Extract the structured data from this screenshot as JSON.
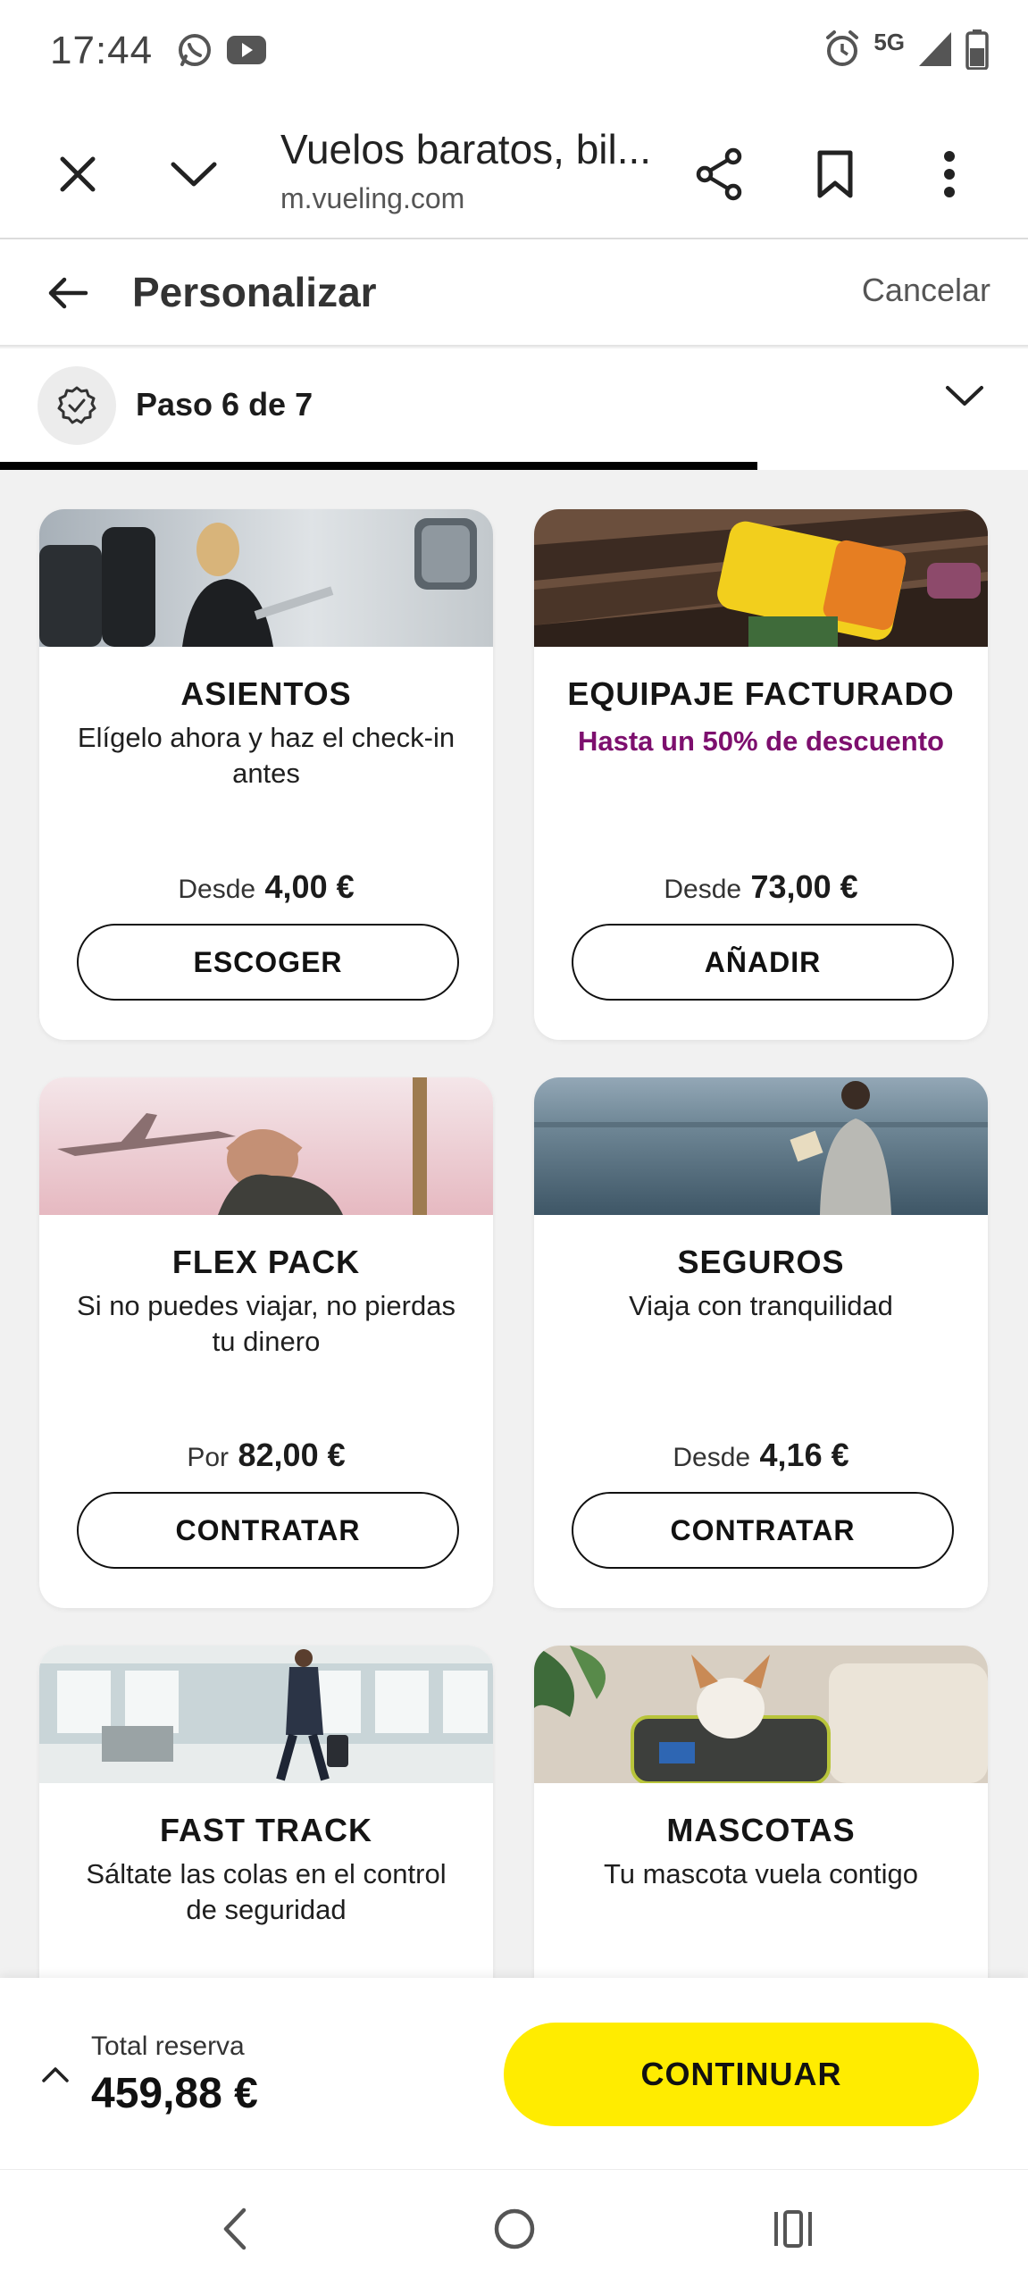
{
  "status_bar": {
    "time": "17:44",
    "left_icons": [
      "whatsapp-icon",
      "youtube-icon"
    ],
    "network": "5G",
    "right_icons": [
      "alarm-icon",
      "signal-icon",
      "battery-icon"
    ]
  },
  "browser": {
    "title": "Vuelos baratos, bil...",
    "url": "m.vueling.com",
    "icons": [
      "close-icon",
      "chevron-down-icon",
      "share-icon",
      "bookmark-icon",
      "more-vert-icon"
    ]
  },
  "header": {
    "title": "Personalizar",
    "cancel_label": "Cancelar"
  },
  "step": {
    "label": "Paso 6 de 7",
    "progress_fraction": 0.857
  },
  "cards": [
    {
      "title": "ASIENTOS",
      "subtitle": "Elígelo ahora y haz el check-in antes",
      "price_prefix": "Desde",
      "price": "4,00 €",
      "button": "ESCOGER"
    },
    {
      "title": "EQUIPAJE FACTURADO",
      "subtitle": "Hasta un 50% de descuento",
      "price_prefix": "Desde",
      "price": "73,00 €",
      "button": "AÑADIR"
    },
    {
      "title": "FLEX PACK",
      "subtitle": "Si no puedes viajar, no pierdas tu dinero",
      "price_prefix": "Por",
      "price": "82,00 €",
      "button": "CONTRATAR"
    },
    {
      "title": "SEGUROS",
      "subtitle": "Viaja con tranquilidad",
      "price_prefix": "Desde",
      "price": "4,16 €",
      "button": "CONTRATAR"
    },
    {
      "title": "FAST TRACK",
      "subtitle": "Sáltate las colas en el control de seguridad"
    },
    {
      "title": "MASCOTAS",
      "subtitle": "Tu mascota vuela contigo"
    }
  ],
  "footer": {
    "total_label": "Total reserva",
    "total_value": "459,88 €",
    "continue_label": "CONTINUAR",
    "accent_color": "#ffec00"
  },
  "nav": {
    "icons": [
      "back-icon",
      "home-icon",
      "recents-icon"
    ]
  }
}
